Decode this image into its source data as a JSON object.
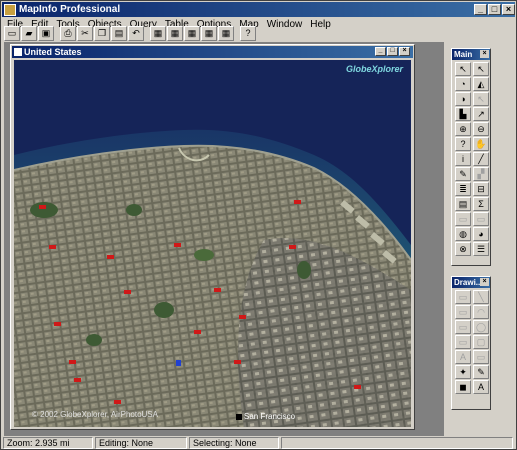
{
  "app": {
    "title": "MapInfo Professional"
  },
  "menu": [
    "File",
    "Edit",
    "Tools",
    "Objects",
    "Query",
    "Table",
    "Options",
    "Map",
    "Window",
    "Help"
  ],
  "window_buttons": {
    "minimize": "_",
    "maximize": "□",
    "close": "×"
  },
  "toolbar": [
    {
      "icon": "new-icon",
      "glyph": "▭"
    },
    {
      "icon": "open-icon",
      "glyph": "▰"
    },
    {
      "icon": "save-icon",
      "glyph": "▣"
    },
    {
      "icon": "print-icon",
      "glyph": "⎙"
    },
    {
      "icon": "cut-icon",
      "glyph": "✂"
    },
    {
      "icon": "copy-icon",
      "glyph": "❐"
    },
    {
      "icon": "paste-icon",
      "glyph": "▤"
    },
    {
      "icon": "undo-icon",
      "glyph": "↶"
    },
    {
      "icon": "new-browser-icon",
      "glyph": "▦"
    },
    {
      "icon": "new-map-icon",
      "glyph": "▦"
    },
    {
      "icon": "new-graph-icon",
      "glyph": "▦"
    },
    {
      "icon": "new-layout-icon",
      "glyph": "▦"
    },
    {
      "icon": "redistrict-icon",
      "glyph": "▦"
    },
    {
      "icon": "help-icon",
      "glyph": "?"
    }
  ],
  "map_window": {
    "title": "United States",
    "watermark": "GlobeXplorer",
    "copyright": "© 2002 GlobeXplorer, AirPhotoUSA",
    "city_label": "San Francisco"
  },
  "main_palette": {
    "title": "Main",
    "close": "×",
    "tools": [
      {
        "icon": "select-icon",
        "glyph": "↖"
      },
      {
        "icon": "marquee-select-icon",
        "glyph": "↖"
      },
      {
        "icon": "radius-select-icon",
        "glyph": "◔"
      },
      {
        "icon": "polygon-select-icon",
        "glyph": "◭"
      },
      {
        "icon": "boundary-select-icon",
        "glyph": "◑"
      },
      {
        "icon": "unselect-all-icon",
        "glyph": "↖"
      },
      {
        "icon": "graph-select-icon",
        "glyph": "▙"
      },
      {
        "icon": "invert-select-icon",
        "glyph": "↗"
      },
      {
        "icon": "zoom-in-icon",
        "glyph": "⊕"
      },
      {
        "icon": "zoom-out-icon",
        "glyph": "⊖"
      },
      {
        "icon": "change-view-icon",
        "glyph": "?"
      },
      {
        "icon": "grabber-icon",
        "glyph": "✋"
      },
      {
        "icon": "info-icon",
        "glyph": "i"
      },
      {
        "icon": "hotlink-icon",
        "glyph": "╱"
      },
      {
        "icon": "label-icon",
        "glyph": "✎"
      },
      {
        "icon": "drag-map-icon",
        "glyph": "▞"
      },
      {
        "icon": "layer-control-icon",
        "glyph": "≣"
      },
      {
        "icon": "ruler-icon",
        "glyph": "⊟"
      },
      {
        "icon": "legend-icon",
        "glyph": "▤"
      },
      {
        "icon": "statistics-icon",
        "glyph": "Σ"
      },
      {
        "icon": "clip-region-icon",
        "glyph": "▭"
      },
      {
        "icon": "set-target-icon",
        "glyph": "▭"
      },
      {
        "icon": "show-legend-icon",
        "glyph": "◍"
      },
      {
        "icon": "show-statistics-icon",
        "glyph": "◕"
      },
      {
        "icon": "globe-icon",
        "glyph": "⊗"
      },
      {
        "icon": "list-icon",
        "glyph": "☰"
      }
    ]
  },
  "drawing_palette": {
    "title": "Drawi...",
    "close": "×",
    "tools": [
      {
        "icon": "symbol-icon",
        "glyph": "▭"
      },
      {
        "icon": "line-icon",
        "glyph": "╲"
      },
      {
        "icon": "polyline-icon",
        "glyph": "▭"
      },
      {
        "icon": "arc-icon",
        "glyph": "◠"
      },
      {
        "icon": "polygon-icon",
        "glyph": "▭"
      },
      {
        "icon": "ellipse-icon",
        "glyph": "◯"
      },
      {
        "icon": "rectangle-icon",
        "glyph": "▭"
      },
      {
        "icon": "rounded-rect-icon",
        "glyph": "▢"
      },
      {
        "icon": "text-icon",
        "glyph": "A"
      },
      {
        "icon": "frame-icon",
        "glyph": "▭"
      },
      {
        "icon": "reshape-icon",
        "glyph": "✦"
      },
      {
        "icon": "add-node-icon",
        "glyph": "✎"
      },
      {
        "icon": "region-style-icon",
        "glyph": "◼"
      },
      {
        "icon": "text-style-icon",
        "glyph": "A"
      }
    ]
  },
  "status": {
    "zoom": "Zoom: 2.935 mi",
    "editing": "Editing: None",
    "selecting": "Selecting: None"
  },
  "colors": {
    "title_blue": "#0a246a",
    "face": "#d4d0c8",
    "water": "#122050"
  }
}
